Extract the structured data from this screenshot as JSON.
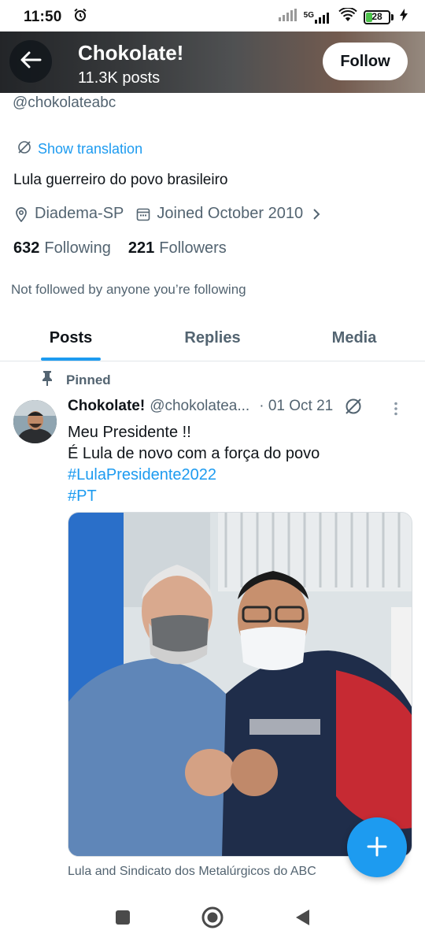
{
  "status_bar": {
    "time": "11:50",
    "network": "5G",
    "battery": "28",
    "battery_level": 0.28
  },
  "header": {
    "title": "Chokolate!",
    "posts_count": "11.3K posts",
    "follow_label": "Follow"
  },
  "profile": {
    "handle": "@chokolateabc",
    "show_translation": "Show translation",
    "bio": "Lula guerreiro do povo brasileiro",
    "location": "Diadema-SP",
    "joined": "Joined October 2010",
    "following_count": "632",
    "following_label": "Following",
    "followers_count": "221",
    "followers_label": "Followers",
    "not_followed": "Not followed by anyone you’re following"
  },
  "tabs": [
    {
      "label": "Posts",
      "active": true
    },
    {
      "label": "Replies",
      "active": false
    },
    {
      "label": "Media",
      "active": false
    }
  ],
  "post": {
    "pinned_label": "Pinned",
    "name": "Chokolate!",
    "handle": "@chokolatea...",
    "date": "· 01 Oct 21",
    "lines": [
      "Meu Presidente !!",
      "É Lula de novo com a força do povo"
    ],
    "hashtags": [
      "#LulaPresidente2022",
      "#PT"
    ],
    "image_caption": "Lula and Sindicato dos Metalúrgicos do ABC"
  },
  "colors": {
    "accent": "#1d9bf0",
    "text_primary": "#0f1419",
    "text_secondary": "#536471"
  }
}
